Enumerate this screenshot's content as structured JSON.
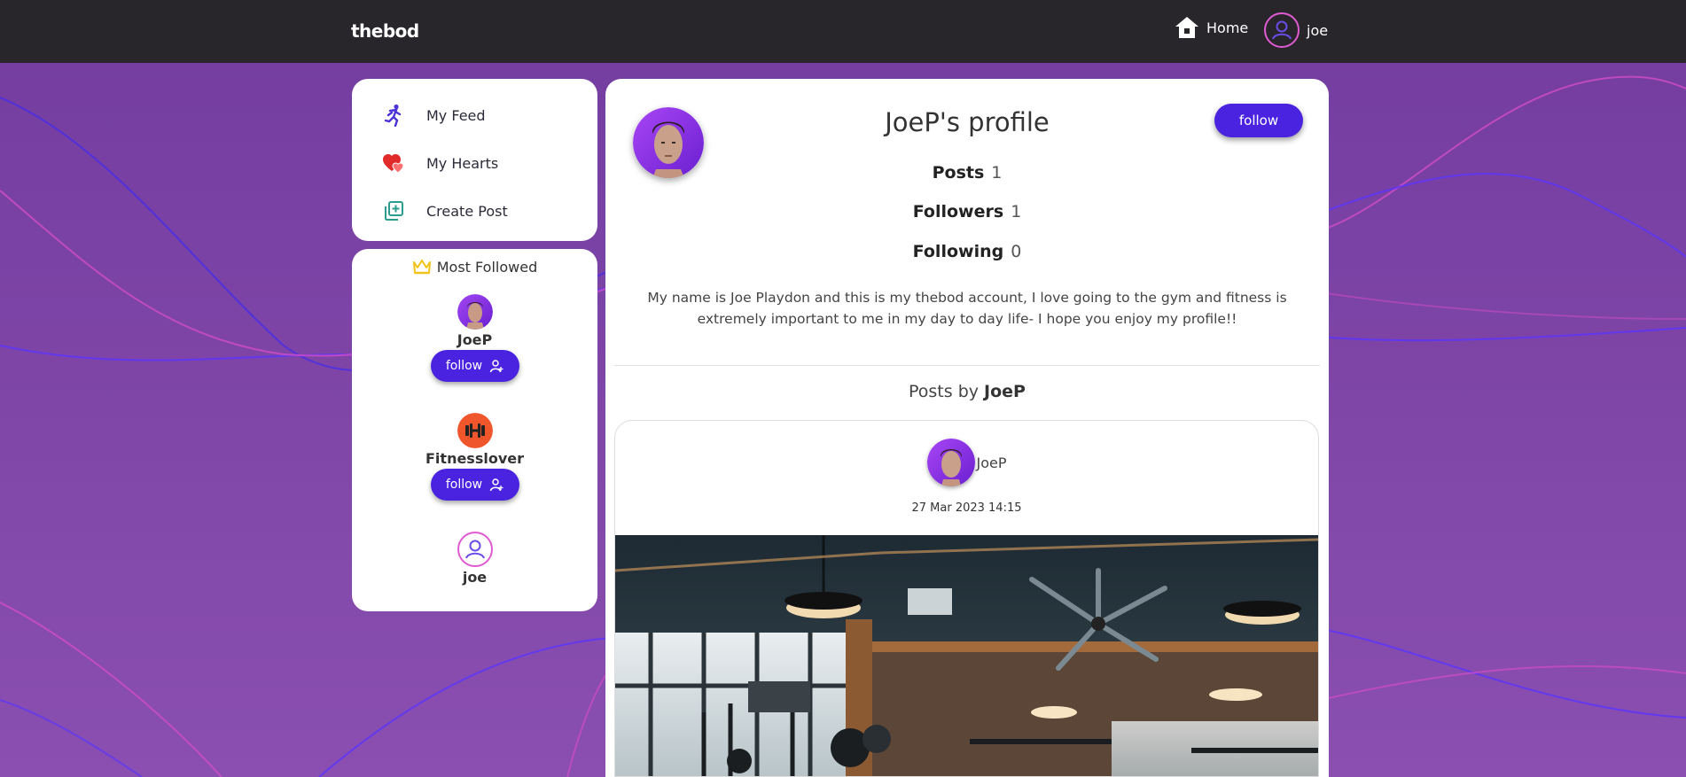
{
  "navbar": {
    "brand": "thebod",
    "home_label": "Home",
    "user_label": "joe"
  },
  "menu": {
    "items": [
      {
        "label": "My Feed",
        "icon": "runner-icon"
      },
      {
        "label": "My Hearts",
        "icon": "hearts-icon"
      },
      {
        "label": "Create Post",
        "icon": "add-post-icon"
      }
    ]
  },
  "most_followed": {
    "title": "Most Followed",
    "users": [
      {
        "name": "JoeP",
        "button": "follow"
      },
      {
        "name": "Fitnesslover",
        "button": "follow"
      },
      {
        "name": "joe"
      }
    ]
  },
  "profile": {
    "title": "JoeP's profile",
    "follow_label": "follow",
    "stats": {
      "posts_label": "Posts",
      "posts_value": "1",
      "followers_label": "Followers",
      "followers_value": "1",
      "following_label": "Following",
      "following_value": "0"
    },
    "bio": "My name is Joe Playdon and this is my thebod account, I love going to the gym and fitness is extremely important to me in my day to day life- I hope you enjoy my profile!!",
    "posts_by_prefix": "Posts by",
    "posts_by_user": "JoeP"
  },
  "post": {
    "author": "JoeP",
    "date": "27 Mar 2023 14:15"
  },
  "colors": {
    "navbar_bg": "#28252b",
    "page_bg": "#7d46a8",
    "accent_button": "#4a23e0",
    "avatar_ring": "#e05bd2",
    "fitness_avatar": "#f0562b"
  }
}
